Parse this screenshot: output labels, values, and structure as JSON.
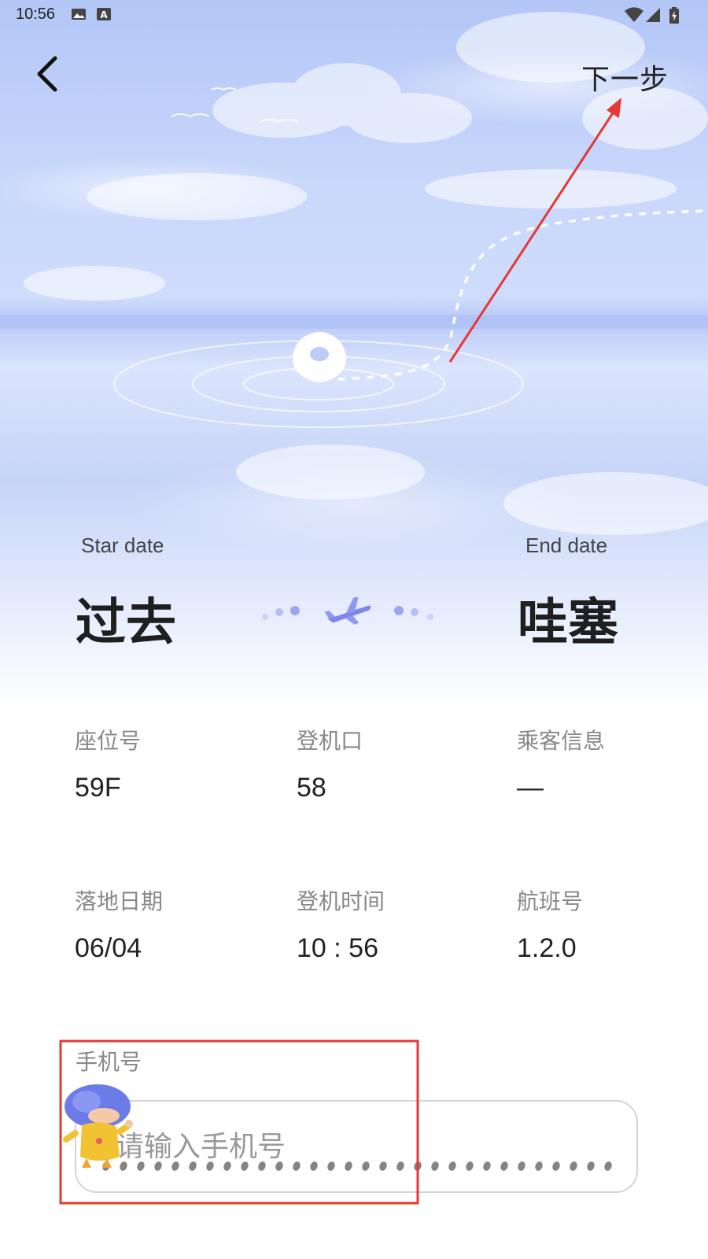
{
  "status_bar": {
    "time": "10:56"
  },
  "header": {
    "next_label": "下一步"
  },
  "route": {
    "start_label": "Star date",
    "start_city": "过去",
    "end_label": "End date",
    "end_city": "哇塞"
  },
  "info": [
    {
      "label": "座位号",
      "value": "59F"
    },
    {
      "label": "登机口",
      "value": "58"
    },
    {
      "label": "乘客信息",
      "value": "—"
    },
    {
      "label": "落地日期",
      "value": "06/04"
    },
    {
      "label": "登机时间",
      "value": "10 : 56"
    },
    {
      "label": "航班号",
      "value": "1.2.0"
    }
  ],
  "phone": {
    "label": "手机号",
    "placeholder": "请输入手机号",
    "value": ""
  },
  "colors": {
    "accent_purple": "#7d86ea",
    "annotation_red": "#e53935"
  },
  "icons": {
    "back": "chevron-left-icon",
    "plane": "airplane-icon",
    "location": "map-pin-icon",
    "wifi": "wifi-icon",
    "signal": "signal-icon",
    "battery": "battery-icon"
  }
}
